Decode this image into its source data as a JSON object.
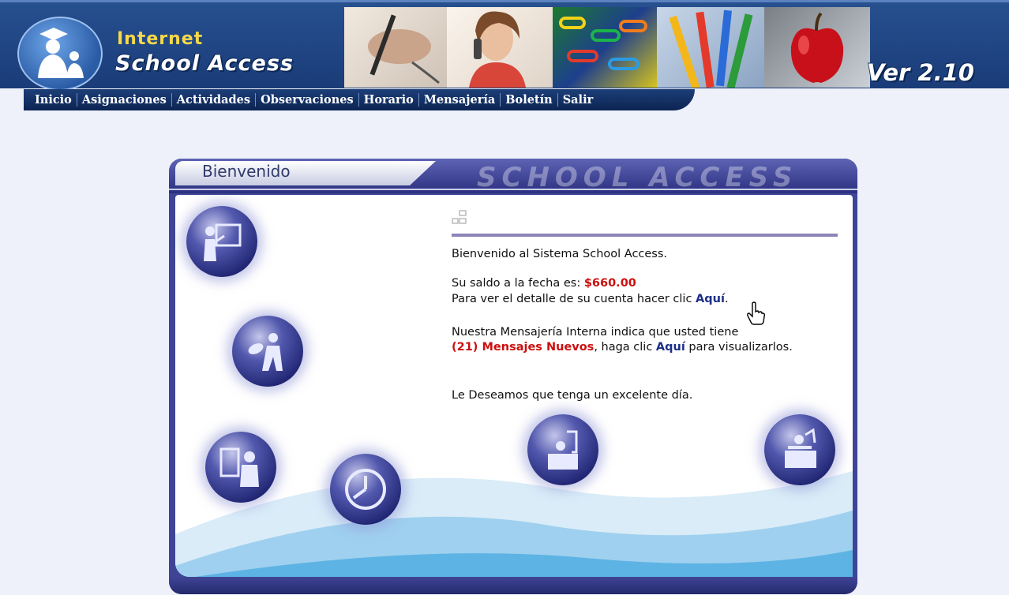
{
  "header": {
    "title_line1": "Internet",
    "title_line2": "School Access",
    "version": "Ver 2.10",
    "brand_color": "#1e4583",
    "accent_color": "#f6d94a"
  },
  "nav": {
    "items": [
      {
        "label": "Inicio"
      },
      {
        "label": "Asignaciones"
      },
      {
        "label": "Actividades"
      },
      {
        "label": "Observaciones"
      },
      {
        "label": "Horario"
      },
      {
        "label": "Mensajería"
      },
      {
        "label": "Boletín"
      },
      {
        "label": "Salir"
      }
    ]
  },
  "panel": {
    "tab_label": "Bienvenido",
    "brand_text": "SCHOOL   ACCESS"
  },
  "content": {
    "welcome": "Bienvenido al Sistema School Access.",
    "balance_label": "Su saldo a la fecha es: ",
    "balance_value": "$660.00",
    "detail_text": "Para ver el detalle de su cuenta hacer clic ",
    "detail_link": "Aquí",
    "detail_end": ".",
    "messages_text": "Nuestra Mensajería Interna indica que usted tiene",
    "messages_count": "(21) Mensajes Nuevos",
    "messages_mid": ", haga clic ",
    "messages_link": "Aquí",
    "messages_end": " para visualizarlos.",
    "farewell": "Le Deseamos que tenga un excelente día.",
    "highlight_color": "#cc1010",
    "link_color": "#1c2f86"
  },
  "icons": [
    {
      "name": "assignments-icon"
    },
    {
      "name": "activities-icon"
    },
    {
      "name": "observations-icon"
    },
    {
      "name": "schedule-icon"
    },
    {
      "name": "messaging-icon"
    },
    {
      "name": "report-card-icon"
    }
  ]
}
